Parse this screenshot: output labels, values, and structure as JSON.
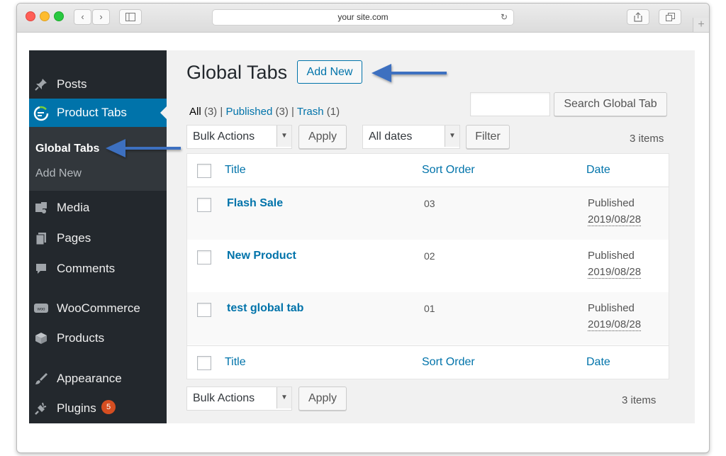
{
  "browser": {
    "url": "your site.com",
    "nav_back": "‹",
    "nav_forward": "›",
    "reload": "↻"
  },
  "sidebar": {
    "items": [
      {
        "label": "Posts",
        "icon": "pin-icon"
      },
      {
        "label": "Product Tabs",
        "icon": "product-tabs-icon",
        "active": true
      },
      {
        "label": "Media",
        "icon": "media-icon"
      },
      {
        "label": "Pages",
        "icon": "pages-icon"
      },
      {
        "label": "Comments",
        "icon": "comment-icon"
      },
      {
        "label": "WooCommerce",
        "icon": "woo-icon"
      },
      {
        "label": "Products",
        "icon": "box-icon"
      },
      {
        "label": "Appearance",
        "icon": "brush-icon"
      },
      {
        "label": "Plugins",
        "icon": "plug-icon",
        "badge": "5"
      }
    ],
    "submenu": [
      "Global Tabs",
      "Add New"
    ]
  },
  "page": {
    "title": "Global Tabs",
    "add_new": "Add New"
  },
  "views": {
    "all": "All",
    "all_count": "(3)",
    "published": "Published",
    "published_count": "(3)",
    "trash": "Trash",
    "trash_count": "(1)",
    "sep": "|"
  },
  "search": {
    "value": "",
    "button": "Search Global Tab"
  },
  "top_nav": {
    "bulk_actions": "Bulk Actions",
    "apply": "Apply",
    "dates": "All dates",
    "filter": "Filter",
    "count": "3 items"
  },
  "table": {
    "columns": [
      "Title",
      "Sort Order",
      "Date"
    ],
    "rows": [
      {
        "title": "Flash Sale",
        "sort": "03",
        "status": "Published",
        "date": "2019/08/28"
      },
      {
        "title": "New Product",
        "sort": "02",
        "status": "Published",
        "date": "2019/08/28"
      },
      {
        "title": "test global tab",
        "sort": "01",
        "status": "Published",
        "date": "2019/08/28"
      }
    ]
  },
  "bottom_nav": {
    "bulk_actions": "Bulk Actions",
    "apply": "Apply",
    "count": "3 items"
  },
  "colors": {
    "wp_blue": "#0073aa",
    "sidebar_bg": "#23282d",
    "arrow": "#3c6fc0",
    "badge": "#d54e21"
  }
}
